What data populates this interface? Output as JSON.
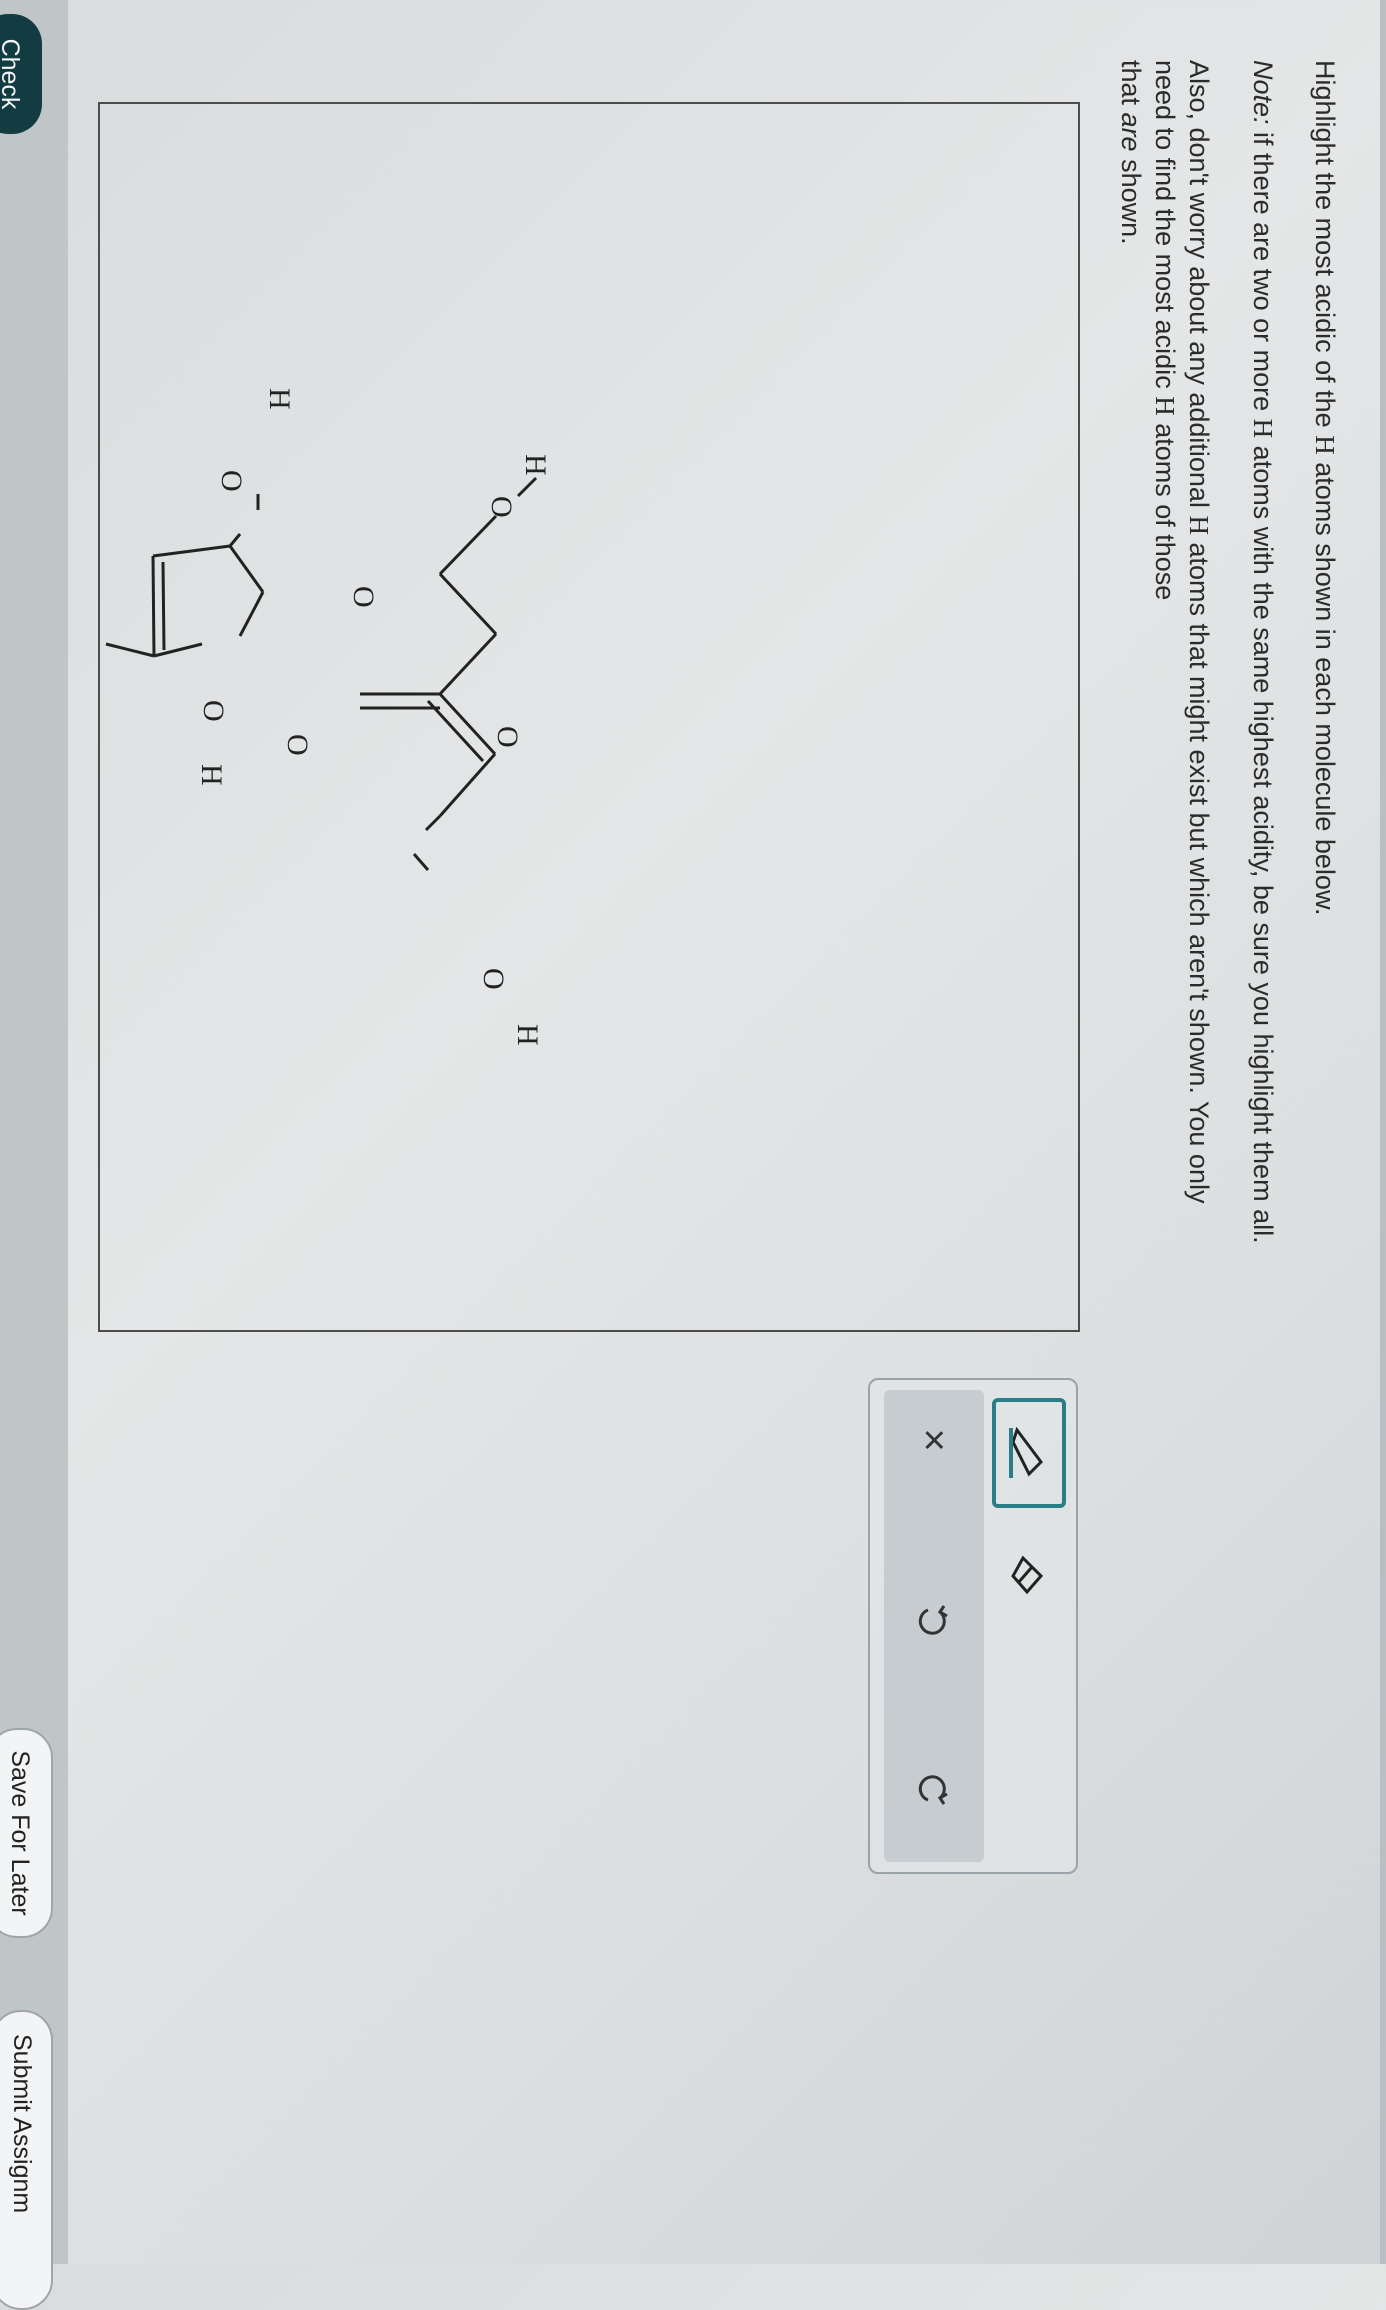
{
  "prompt": {
    "line1_pre": "Highlight the most acidic of the ",
    "line1_h": "H",
    "line1_post": " atoms shown in each molecule below.",
    "note_label": "Note:",
    "note_pre": " if there are two or more ",
    "note_h": "H",
    "note_post": " atoms with the same highest acidity, be sure you highlight them all.",
    "also_a": "Also, don't worry about any additional ",
    "also_h1": "H",
    "also_b": " atoms that might exist but which aren't shown. You only need to find the most acidic ",
    "also_h2": "H",
    "also_c": " atoms of those",
    "also_d1": "that ",
    "also_d_italic": "are",
    "also_d2": " shown."
  },
  "molecules": {
    "atom_H": "H",
    "atom_O": "O"
  },
  "toolbar": {
    "pencil_icon": "highlighter-pencil-icon",
    "eraser_icon": "eraser-icon",
    "clear_icon": "close-x-icon",
    "undo_icon": "undo-icon",
    "redo_icon": "redo-icon",
    "clear_label": "×"
  },
  "buttons": {
    "check": "Check",
    "save": "Save For Later",
    "submit": "Submit Assignm"
  },
  "colors": {
    "accent": "#2a7f86",
    "check_bg": "#123b42"
  }
}
